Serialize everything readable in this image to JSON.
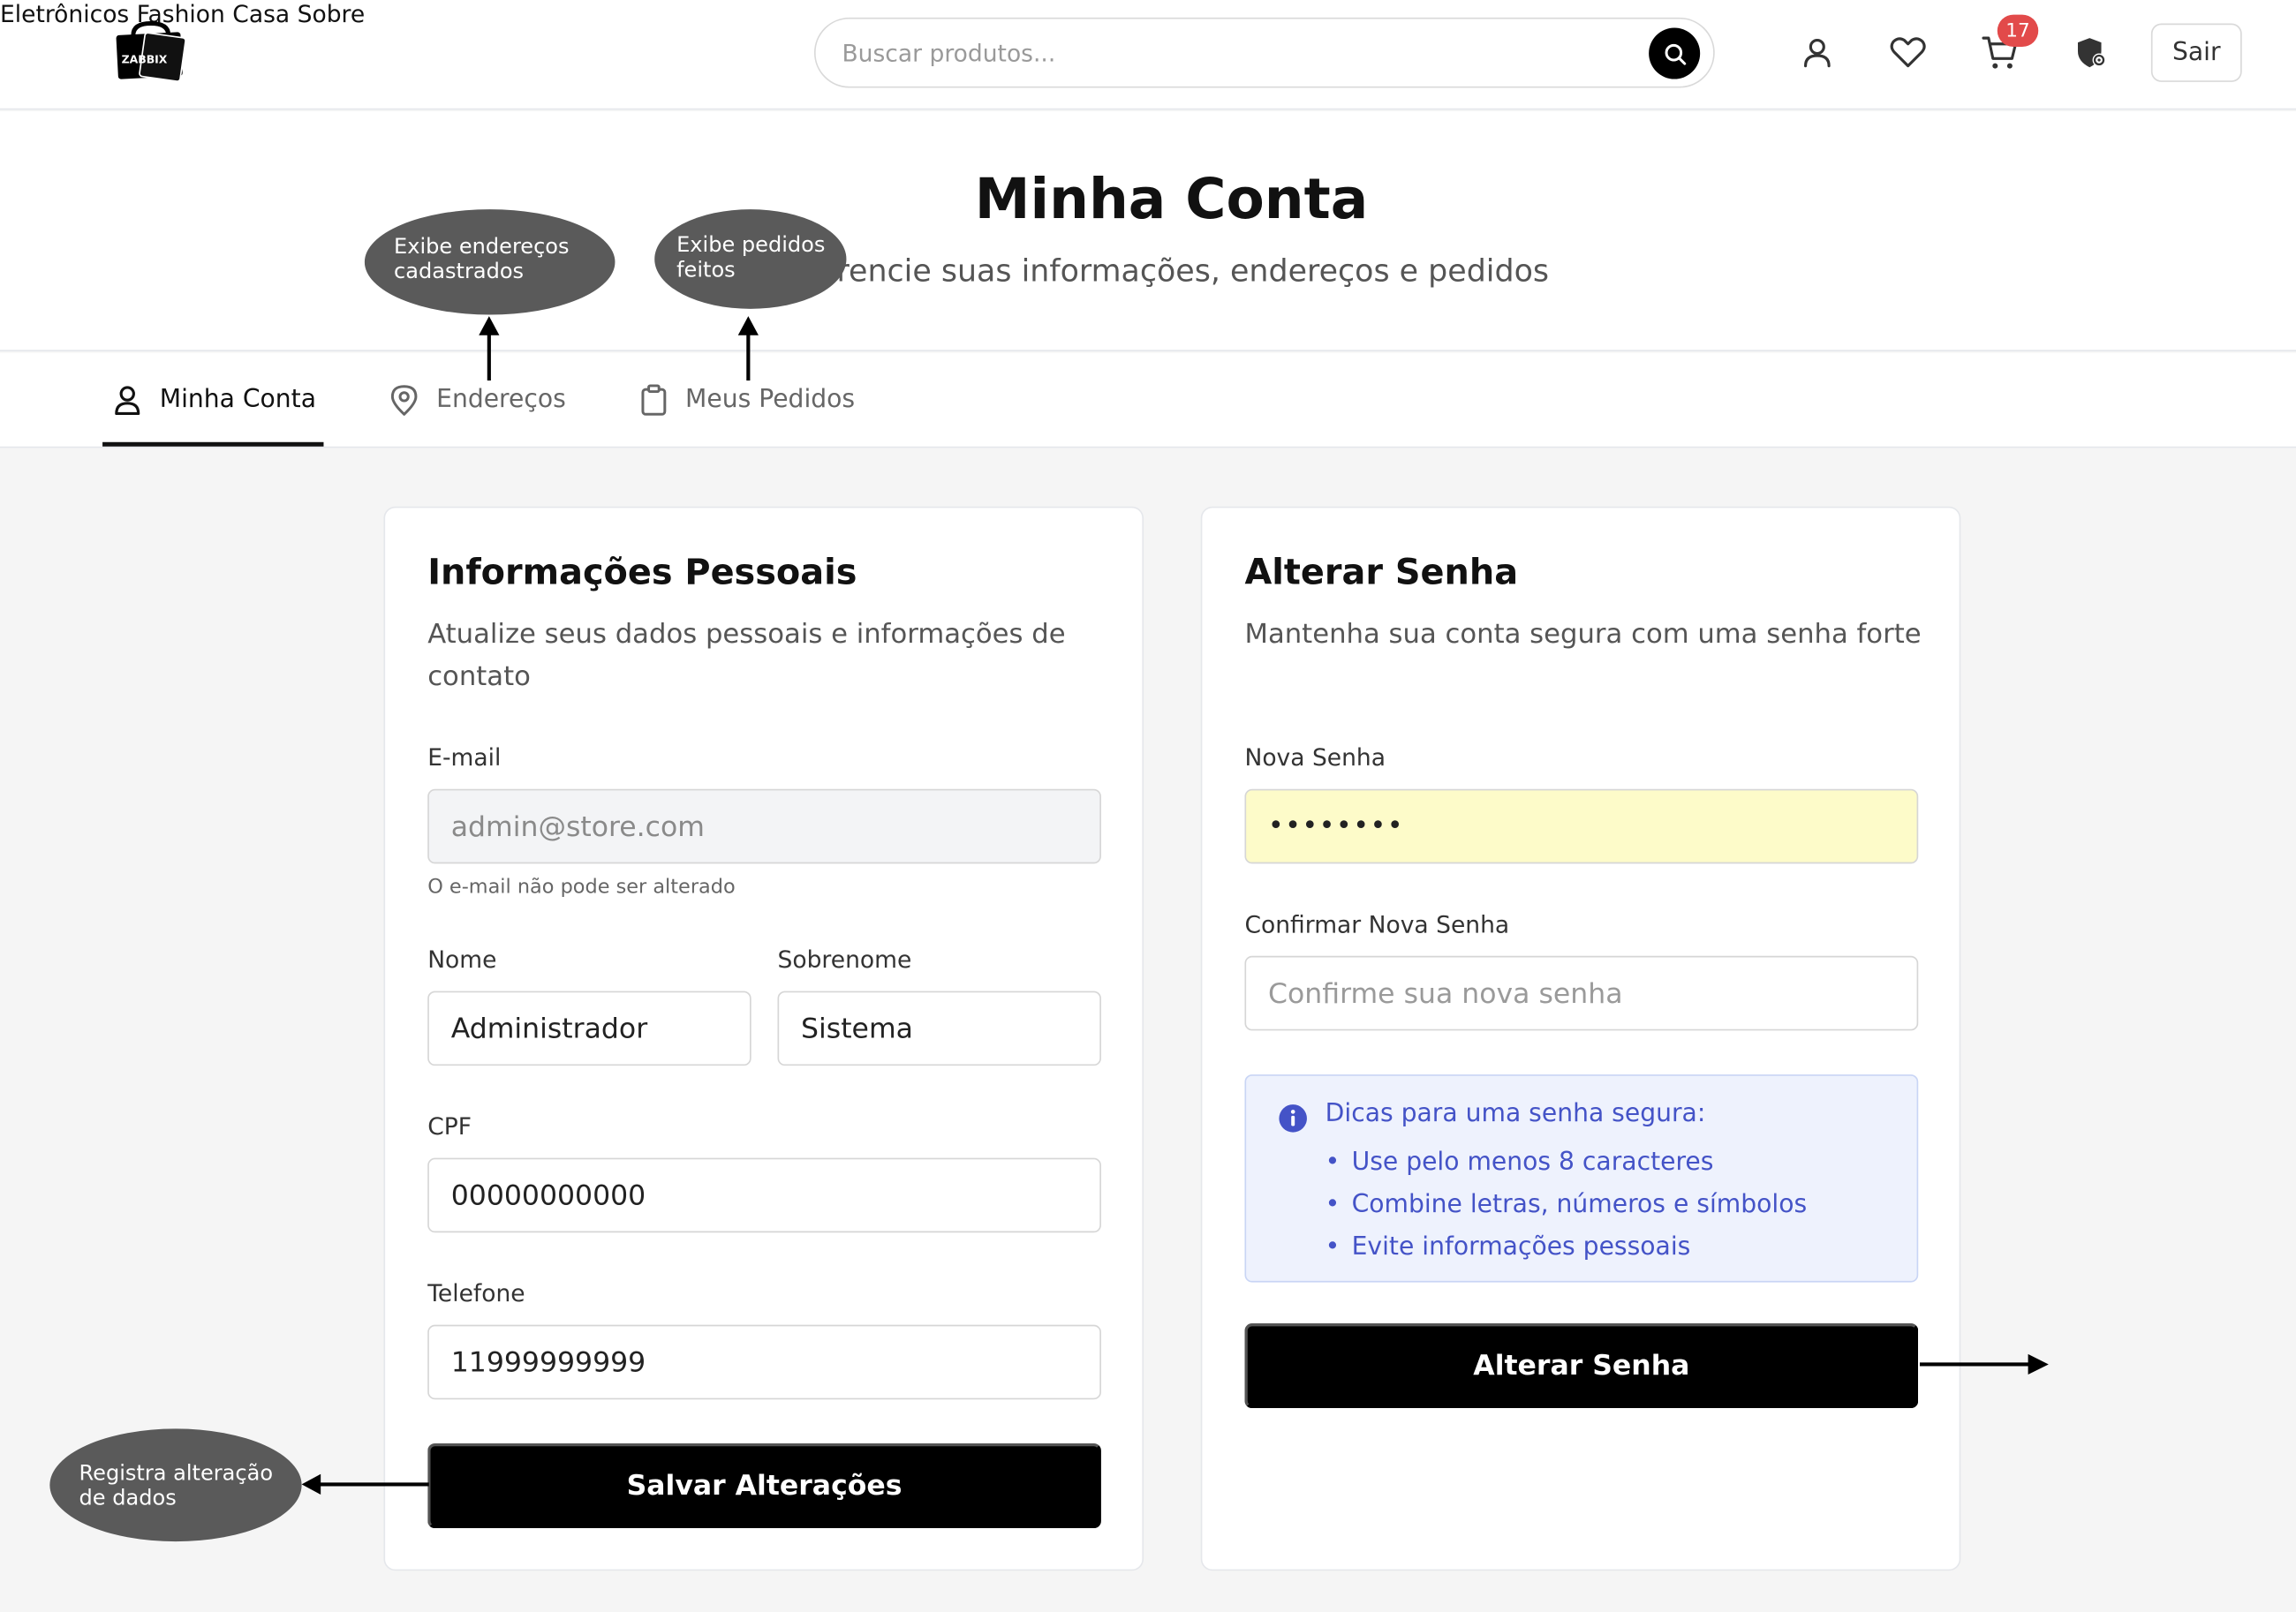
{
  "header": {
    "logo_text": "ZABBIX",
    "nav": [
      "Eletrônicos",
      "Fashion",
      "Casa",
      "Sobre"
    ],
    "search_placeholder": "Buscar produtos...",
    "cart_count": "17",
    "logout_label": "Sair"
  },
  "hero": {
    "title": "Minha Conta",
    "subtitle": "Gerencie suas informações, endereços e pedidos"
  },
  "tabs": [
    {
      "label": "Minha Conta",
      "active": true
    },
    {
      "label": "Endereços",
      "active": false
    },
    {
      "label": "Meus Pedidos",
      "active": false
    }
  ],
  "personal": {
    "title": "Informações Pessoais",
    "description": "Atualize seus dados pessoais e informações de contato",
    "email_label": "E-mail",
    "email_value": "admin@store.com",
    "email_hint": "O e-mail não pode ser alterado",
    "first_name_label": "Nome",
    "first_name_value": "Administrador",
    "last_name_label": "Sobrenome",
    "last_name_value": "Sistema",
    "cpf_label": "CPF",
    "cpf_value": "00000000000",
    "phone_label": "Telefone",
    "phone_value": "11999999999",
    "save_button": "Salvar Alterações"
  },
  "password": {
    "title": "Alterar Senha",
    "description": "Mantenha sua conta segura com uma senha forte",
    "new_label": "Nova Senha",
    "new_value": "••••••••",
    "confirm_label": "Confirmar Nova Senha",
    "confirm_placeholder": "Confirme sua nova senha",
    "tips_title": "Dicas para uma senha segura:",
    "tips": [
      "Use pelo menos 8 caracteres",
      "Combine letras, números e símbolos",
      "Evite informações pessoais"
    ],
    "change_button": "Alterar Senha"
  },
  "annotations": {
    "addresses": "Exibe endereços cadastrados",
    "orders": "Exibe pedidos feitos",
    "save": "Registra alteração de dados"
  },
  "colors": {
    "accent": "#000000",
    "badge": "#e24a4a",
    "tips_text": "#4453c7",
    "password_fill": "#fdfbc9",
    "annotation": "#5a5a5a"
  }
}
